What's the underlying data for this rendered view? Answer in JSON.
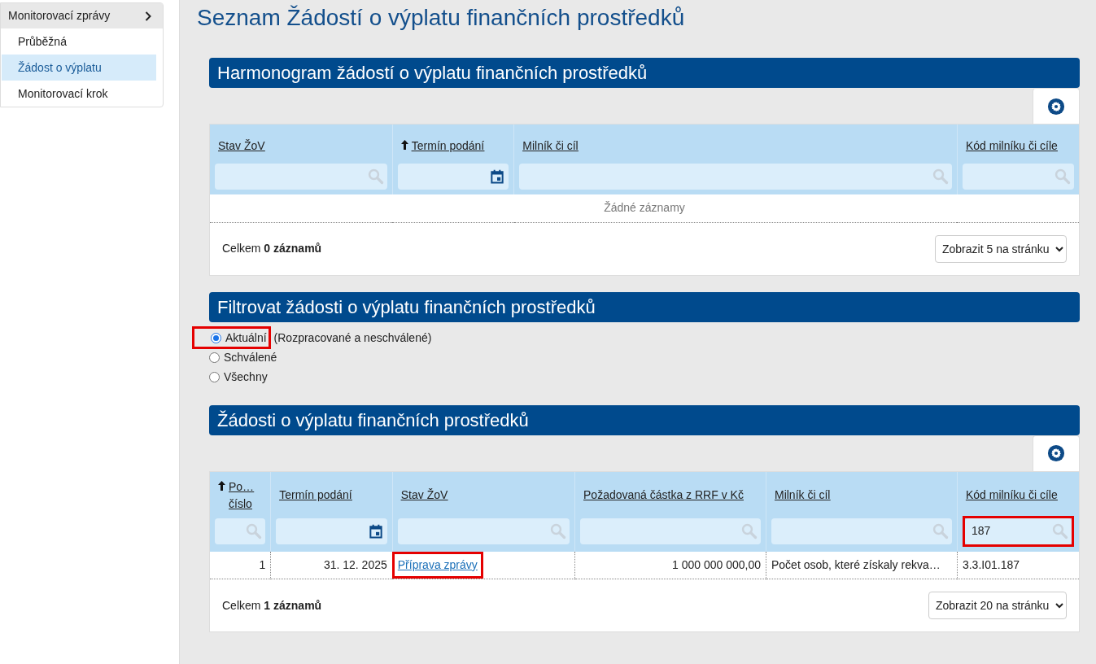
{
  "sidebar": {
    "group": {
      "label": "Monitorovací zprávy",
      "expanded": true
    },
    "items": [
      {
        "label": "Průběžná",
        "selected": false
      },
      {
        "label": "Žádost o výplatu",
        "selected": true
      },
      {
        "label": "Monitorovací krok",
        "selected": false
      }
    ]
  },
  "page_title": "Seznam Žádostí o výplatu finančních prostředků",
  "sections": [
    {
      "kind": "table",
      "title": "Harmonogram žádostí o výplatu finančních prostředků",
      "table": {
        "columns": [
          {
            "label": "Stav ŽoV",
            "sorted": false,
            "filter": {
              "kind": "search",
              "highlighted": false
            }
          },
          {
            "label": "Termín podání",
            "sorted": true,
            "filter": {
              "kind": "date",
              "highlighted": false
            }
          },
          {
            "label": "Milník či cíl",
            "sorted": false,
            "filter": {
              "kind": "search",
              "highlighted": false
            }
          },
          {
            "label": "Kód milníku či cíle",
            "sorted": false,
            "filter": {
              "kind": "search",
              "highlighted": false
            }
          }
        ],
        "empty_text": "Žádné záznamy",
        "total_prefix": "Celkem ",
        "total_bold": "0 záznamů",
        "page_size": "Zobrazit 5 na stránku"
      }
    },
    {
      "kind": "filter",
      "title": "Filtrovat žádosti o výplatu finančních prostředků",
      "options": [
        {
          "label": "Aktuální",
          "note": "(Rozpracované a neschválené)",
          "selected": true,
          "highlighted": true
        },
        {
          "label": "Schválené",
          "selected": false,
          "highlighted": false
        },
        {
          "label": "Všechny",
          "selected": false,
          "highlighted": false
        }
      ]
    },
    {
      "kind": "table",
      "title": "Žádosti o výplatu finančních prostředků",
      "table": {
        "columns": [
          {
            "label": "Po… číslo",
            "sorted": true,
            "filter": {
              "kind": "search",
              "highlighted": false
            }
          },
          {
            "label": "Termín podání",
            "sorted": false,
            "filter": {
              "kind": "date",
              "highlighted": false
            }
          },
          {
            "label": "Stav ŽoV",
            "sorted": false,
            "filter": {
              "kind": "search",
              "highlighted": false
            }
          },
          {
            "label": "Požadovaná částka z RRF v Kč",
            "sorted": false,
            "filter": {
              "kind": "search",
              "highlighted": false
            }
          },
          {
            "label": "Milník či cíl",
            "sorted": false,
            "filter": {
              "kind": "search",
              "highlighted": false
            }
          },
          {
            "label": "Kód milníku či cíle",
            "sorted": false,
            "filter": {
              "kind": "search",
              "highlighted": true,
              "value": "187"
            }
          }
        ],
        "rows": [
          [
            {
              "text": "1",
              "kind": "number",
              "highlighted": false
            },
            {
              "text": "31. 12. 2025",
              "kind": "date",
              "highlighted": false
            },
            {
              "text": "Příprava zprávy",
              "kind": "link",
              "highlighted": true
            },
            {
              "text": "1 000 000 000,00",
              "kind": "number",
              "highlighted": false
            },
            {
              "text": "Počet osob, které získaly rekva…",
              "kind": "text",
              "highlighted": false
            },
            {
              "text": "3.3.I01.187",
              "kind": "text",
              "highlighted": false
            }
          ]
        ],
        "total_prefix": "Celkem ",
        "total_bold": "1 záznamů",
        "page_size": "Zobrazit 20 na stránku"
      }
    }
  ]
}
